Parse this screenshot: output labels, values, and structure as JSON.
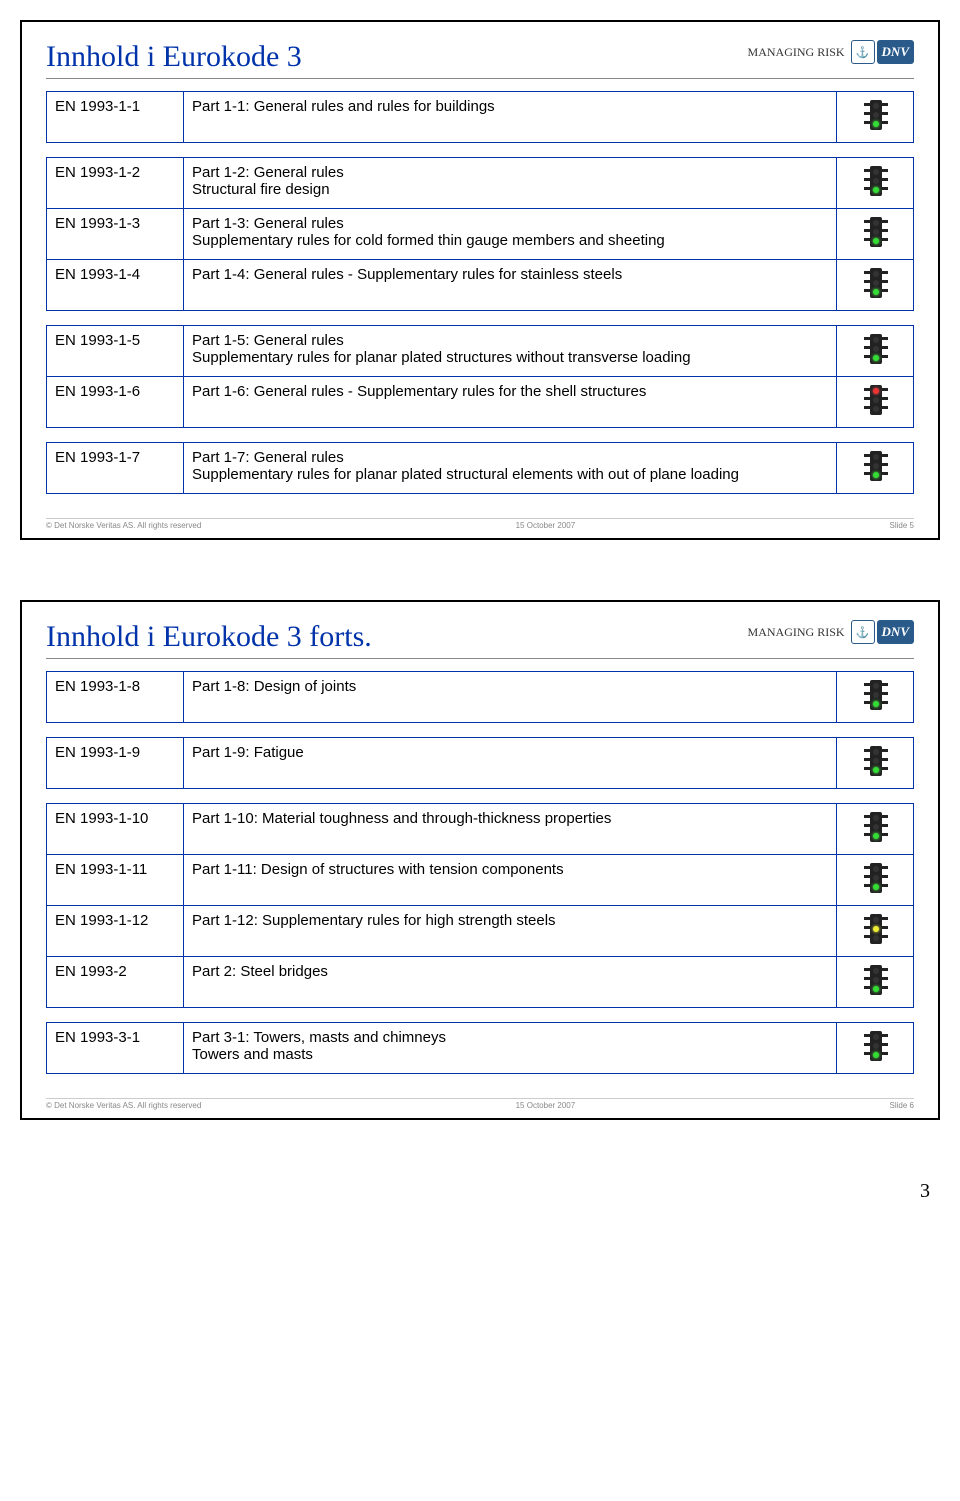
{
  "brand": {
    "managing_risk": "MANAGING RISK",
    "dnv": "DNV",
    "logo_symbols": "⚓"
  },
  "slide1": {
    "title": "Innhold i Eurokode 3",
    "rows": [
      {
        "code": "EN 1993-1-1",
        "desc": "Part 1-1: General rules and rules for buildings",
        "light": "green"
      },
      {
        "code": "EN 1993-1-2",
        "desc": "Part 1-2: General rules\nStructural fire design",
        "light": "green"
      },
      {
        "code": "EN 1993-1-3",
        "desc": "Part 1-3: General rules\nSupplementary rules for cold formed thin gauge members and sheeting",
        "light": "green"
      },
      {
        "code": "EN 1993-1-4",
        "desc": "Part 1-4: General rules - Supplementary rules for stainless steels",
        "light": "green"
      },
      {
        "code": "EN 1993-1-5",
        "desc": "Part 1-5: General rules\nSupplementary rules for planar plated structures without transverse loading",
        "light": "green"
      },
      {
        "code": "EN 1993-1-6",
        "desc": "Part 1-6: General rules - Supplementary rules for the shell structures",
        "light": "red"
      },
      {
        "code": "EN 1993-1-7",
        "desc": "Part 1-7: General rules\nSupplementary rules for planar plated structural elements with out of plane loading",
        "light": "green"
      }
    ],
    "groups": [
      [
        0
      ],
      [
        1,
        2,
        3
      ],
      [
        4,
        5
      ],
      [
        6
      ]
    ],
    "footer": {
      "left": "© Det Norske Veritas AS. All rights reserved",
      "center": "15 October 2007",
      "right": "Slide 5"
    }
  },
  "slide2": {
    "title": "Innhold i Eurokode 3 forts.",
    "rows": [
      {
        "code": "EN 1993-1-8",
        "desc": "Part 1-8: Design of joints",
        "light": "green"
      },
      {
        "code": "EN 1993-1-9",
        "desc": "Part 1-9: Fatigue",
        "light": "green"
      },
      {
        "code": "EN 1993-1-10",
        "desc": "Part 1-10: Material toughness and through-thickness properties",
        "light": "green"
      },
      {
        "code": "EN 1993-1-11",
        "desc": "Part 1-11: Design of structures with tension components",
        "light": "green"
      },
      {
        "code": "EN 1993-1-12",
        "desc": "Part 1-12: Supplementary rules for high strength steels",
        "light": "yellow"
      },
      {
        "code": "EN 1993-2",
        "desc": "Part 2: Steel bridges",
        "light": "green"
      },
      {
        "code": "EN 1993-3-1",
        "desc": "Part 3-1: Towers, masts and chimneys\nTowers and masts",
        "light": "green"
      }
    ],
    "groups": [
      [
        0
      ],
      [
        1
      ],
      [
        2,
        3,
        4,
        5
      ],
      [
        6
      ]
    ],
    "footer": {
      "left": "© Det Norske Veritas AS. All rights reserved",
      "center": "15 October 2007",
      "right": "Slide 6"
    }
  },
  "page_number": "3"
}
